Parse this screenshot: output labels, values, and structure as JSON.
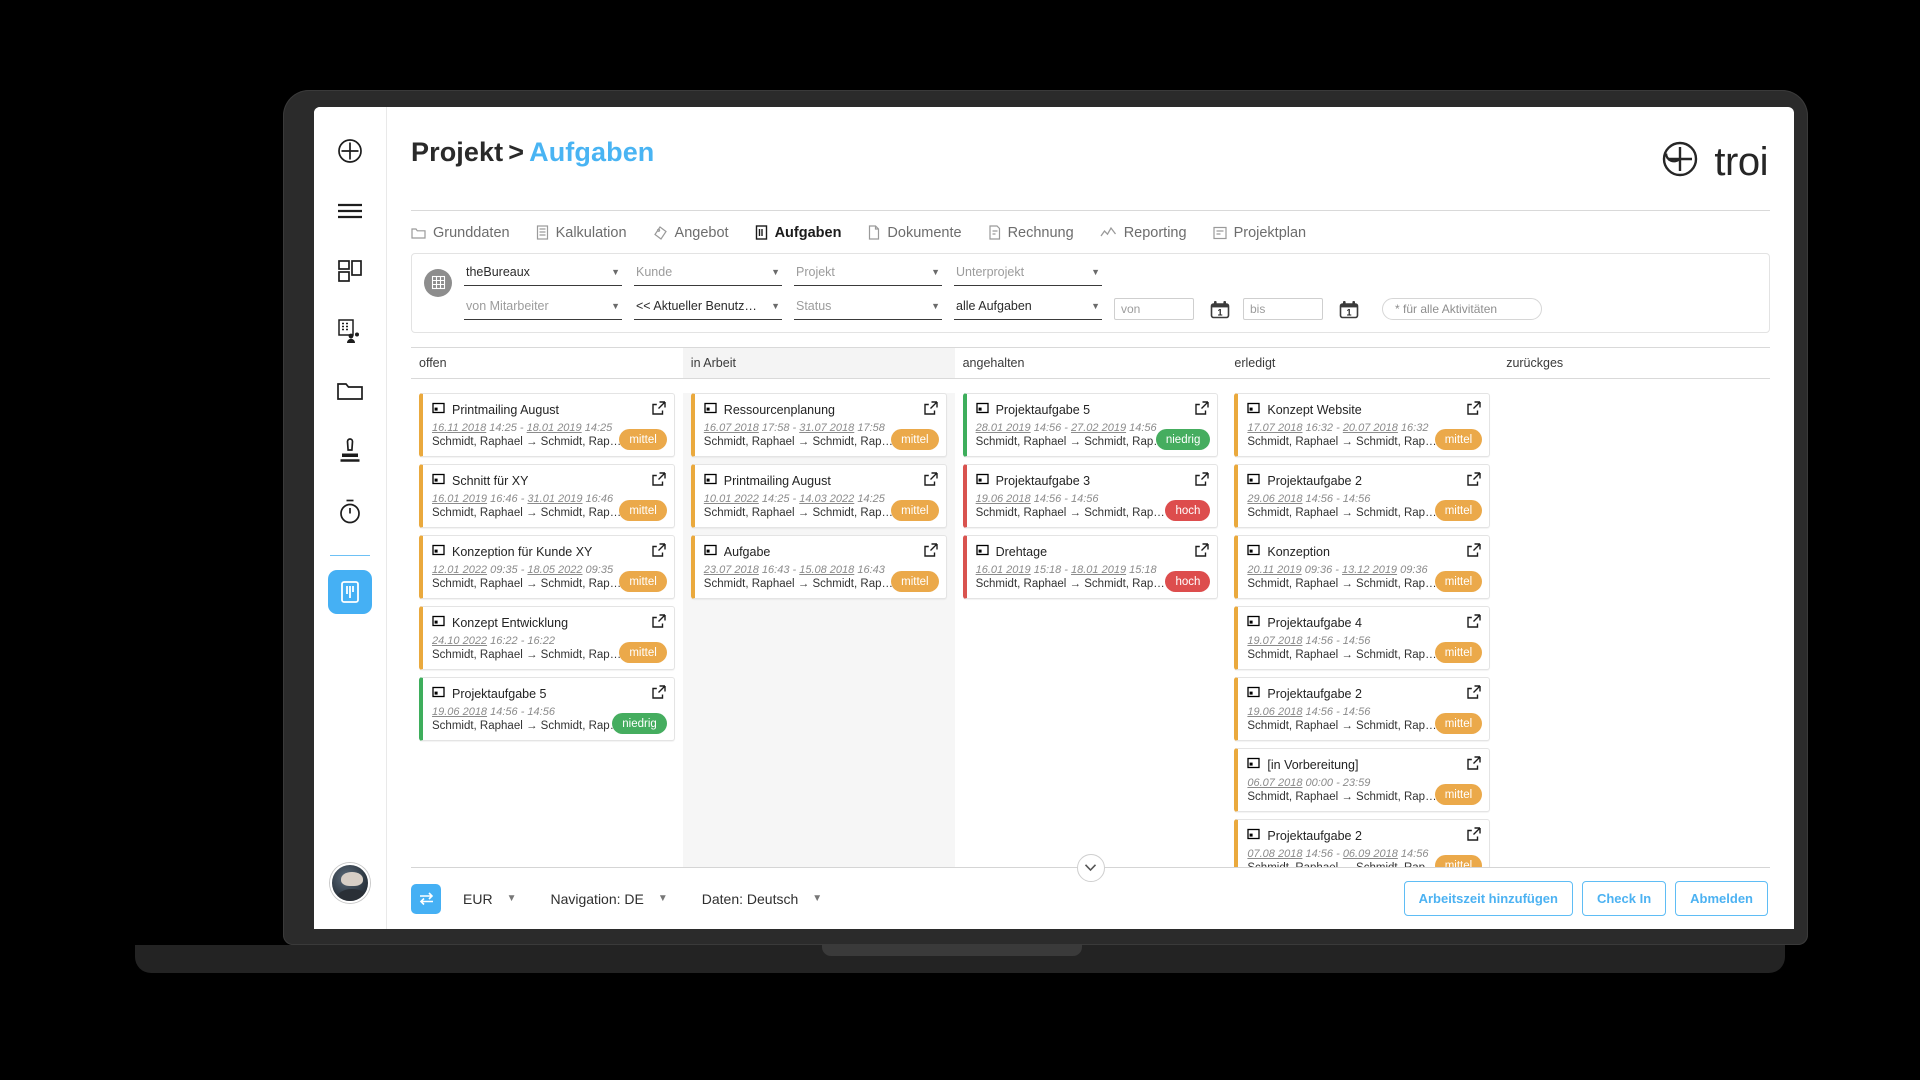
{
  "brand": {
    "name": "troi",
    "logo_icon": "troi-plus-circle-icon"
  },
  "breadcrumb": {
    "parent": "Projekt",
    "separator": ">",
    "current": "Aufgaben"
  },
  "sidebar": {
    "items": [
      {
        "icon": "plus-circle-icon",
        "name": "add"
      },
      {
        "icon": "hamburger-menu-icon",
        "name": "menu"
      },
      {
        "icon": "dashboard-blocks-icon",
        "name": "dashboard"
      },
      {
        "icon": "company-contacts-icon",
        "name": "contacts"
      },
      {
        "icon": "folder-icon",
        "name": "projects"
      },
      {
        "icon": "stamp-icon",
        "name": "approvals"
      },
      {
        "icon": "stopwatch-icon",
        "name": "time-tracking"
      },
      {
        "icon": "kanban-board-icon",
        "name": "tasks-board",
        "active": true
      }
    ],
    "avatar_label": "user-avatar"
  },
  "tabs": [
    {
      "label": "Grunddaten",
      "icon": "folder-tab-icon",
      "active": false
    },
    {
      "label": "Kalkulation",
      "icon": "calculator-icon",
      "active": false
    },
    {
      "label": "Angebot",
      "icon": "tag-icon",
      "active": false
    },
    {
      "label": "Aufgaben",
      "icon": "tasks-icon",
      "active": true
    },
    {
      "label": "Dokumente",
      "icon": "document-icon",
      "active": false
    },
    {
      "label": "Rechnung",
      "icon": "invoice-icon",
      "active": false
    },
    {
      "label": "Reporting",
      "icon": "chart-line-icon",
      "active": false
    },
    {
      "label": "Projektplan",
      "icon": "plan-icon",
      "active": false
    }
  ],
  "filters": {
    "badge_icon": "grid-icon",
    "row1": [
      {
        "value": "theBureaux",
        "placeholder": false,
        "name": "client-group-select"
      },
      {
        "value": "Kunde",
        "placeholder": true,
        "name": "kunde-select"
      },
      {
        "value": "Projekt",
        "placeholder": true,
        "name": "projekt-select"
      },
      {
        "value": "Unterprojekt",
        "placeholder": true,
        "name": "unterprojekt-select"
      }
    ],
    "row2": [
      {
        "value": "von Mitarbeiter",
        "placeholder": true,
        "name": "mitarbeiter-select"
      },
      {
        "value": "<< Aktueller Benutzer >>",
        "placeholder": false,
        "name": "benutzer-select"
      },
      {
        "value": "Status",
        "placeholder": true,
        "name": "status-select"
      },
      {
        "value": "alle Aufgaben",
        "placeholder": false,
        "name": "aufgaben-select"
      }
    ],
    "date_from_placeholder": "von",
    "date_to_placeholder": "bis",
    "activity_placeholder": "* für alle Aktivitäten",
    "calendar_icon": "calendar-icon",
    "calendar_day": "1"
  },
  "board": {
    "columns": [
      {
        "header": "offen",
        "shaded": false,
        "cards": [
          {
            "title": "Printmailing August",
            "date_start": "16.11 2018",
            "time_start": "14:25",
            "date_end": "18.01 2019",
            "time_end": "14:25",
            "people": "Schmidt, Raphael → Schmidt, Raphael",
            "priority": "mittel"
          },
          {
            "title": "Schnitt für XY",
            "date_start": "16.01 2019",
            "time_start": "16:46",
            "date_end": "31.01 2019",
            "time_end": "16:46",
            "people": "Schmidt, Raphael → Schmidt, Raphael",
            "priority": "mittel"
          },
          {
            "title": "Konzeption für Kunde XY",
            "date_start": "12.01 2022",
            "time_start": "09:35",
            "date_end": "18.05 2022",
            "time_end": "09:35",
            "people": "Schmidt, Raphael → Schmidt, Raphael",
            "priority": "mittel"
          },
          {
            "title": "Konzept Entwicklung",
            "date_start": "24.10 2022",
            "time_start": "16:22",
            "date_end": "",
            "time_end": "16:22",
            "people": "Schmidt, Raphael → Schmidt, Raphael",
            "priority": "mittel"
          },
          {
            "title": "Projektaufgabe 5",
            "date_start": "19.06 2018",
            "time_start": "14:56",
            "date_end": "",
            "time_end": "14:56",
            "people": "Schmidt, Raphael → Schmidt, Raphael",
            "priority": "niedrig"
          }
        ]
      },
      {
        "header": "in Arbeit",
        "shaded": true,
        "cards": [
          {
            "title": "Ressourcenplanung",
            "date_start": "16.07 2018",
            "time_start": "17:58",
            "date_end": "31.07 2018",
            "time_end": "17:58",
            "people": "Schmidt, Raphael → Schmidt, Raphael",
            "priority": "mittel"
          },
          {
            "title": "Printmailing August",
            "date_start": "10.01 2022",
            "time_start": "14:25",
            "date_end": "14.03 2022",
            "time_end": "14:25",
            "people": "Schmidt, Raphael → Schmidt, Raphael",
            "priority": "mittel"
          },
          {
            "title": "Aufgabe",
            "date_start": "23.07 2018",
            "time_start": "16:43",
            "date_end": "15.08 2018",
            "time_end": "16:43",
            "people": "Schmidt, Raphael → Schmidt, Raphael",
            "priority": "mittel"
          }
        ]
      },
      {
        "header": "angehalten",
        "shaded": false,
        "cards": [
          {
            "title": "Projektaufgabe 5",
            "date_start": "28.01 2019",
            "time_start": "14:56",
            "date_end": "27.02 2019",
            "time_end": "14:56",
            "people": "Schmidt, Raphael → Schmidt, Raphael",
            "priority": "niedrig"
          },
          {
            "title": "Projektaufgabe 3",
            "date_start": "19.06 2018",
            "time_start": "14:56",
            "date_end": "",
            "time_end": "14:56",
            "people": "Schmidt, Raphael → Schmidt, Raphael",
            "priority": "hoch"
          },
          {
            "title": "Drehtage",
            "date_start": "16.01 2019",
            "time_start": "15:18",
            "date_end": "18.01 2019",
            "time_end": "15:18",
            "people": "Schmidt, Raphael → Schmidt, Raphael",
            "priority": "hoch"
          }
        ]
      },
      {
        "header": "erledigt",
        "shaded": false,
        "cards": [
          {
            "title": "Konzept Website",
            "date_start": "17.07 2018",
            "time_start": "16:32",
            "date_end": "20.07 2018",
            "time_end": "16:32",
            "people": "Schmidt, Raphael → Schmidt, Raphael",
            "priority": "mittel"
          },
          {
            "title": "Projektaufgabe 2",
            "date_start": "29.06 2018",
            "time_start": "14:56",
            "date_end": "",
            "time_end": "14:56",
            "people": "Schmidt, Raphael → Schmidt, Raphael",
            "priority": "mittel"
          },
          {
            "title": "Konzeption",
            "date_start": "20.11 2019",
            "time_start": "09:36",
            "date_end": "13.12 2019",
            "time_end": "09:36",
            "people": "Schmidt, Raphael → Schmidt, Raphael",
            "priority": "mittel"
          },
          {
            "title": "Projektaufgabe 4",
            "date_start": "19.07 2018",
            "time_start": "14:56",
            "date_end": "",
            "time_end": "14:56",
            "people": "Schmidt, Raphael → Schmidt, Raphael",
            "priority": "mittel"
          },
          {
            "title": "Projektaufgabe 2",
            "date_start": "19.06 2018",
            "time_start": "14:56",
            "date_end": "",
            "time_end": "14:56",
            "people": "Schmidt, Raphael → Schmidt, Raphael",
            "priority": "mittel"
          },
          {
            "title": "[in Vorbereitung]",
            "date_start": "06.07 2018",
            "time_start": "00:00",
            "date_end": "",
            "time_end": "23:59",
            "people": "Schmidt, Raphael → Schmidt, Raphael",
            "priority": "mittel"
          },
          {
            "title": "Projektaufgabe 2",
            "date_start": "07.08 2018",
            "time_start": "14:56",
            "date_end": "06.09 2018",
            "time_end": "14:56",
            "people": "Schmidt, Raphael → Schmidt, Raphael",
            "priority": "mittel"
          }
        ]
      },
      {
        "header": "zurückges",
        "shaded": false,
        "cards": []
      }
    ],
    "card_icon": "task-card-icon",
    "open_icon": "open-external-icon"
  },
  "footer": {
    "toggle_icon": "swap-arrows-icon",
    "collapse_icon": "chevron-down-icon",
    "currency": "EUR",
    "navigation_language": "Navigation: DE",
    "data_language": "Daten: Deutsch",
    "buttons": [
      {
        "label": "Arbeitszeit hinzufügen",
        "name": "add-worktime-button"
      },
      {
        "label": "Check In",
        "name": "check-in-button"
      },
      {
        "label": "Abmelden",
        "name": "logout-button"
      }
    ]
  },
  "colors": {
    "accent": "#45b0f4",
    "priority_mittel": "#eba94a",
    "priority_niedrig": "#45ad5f",
    "priority_hoch": "#dd4d4d",
    "breadcrumb_current": "#49b4f3"
  }
}
